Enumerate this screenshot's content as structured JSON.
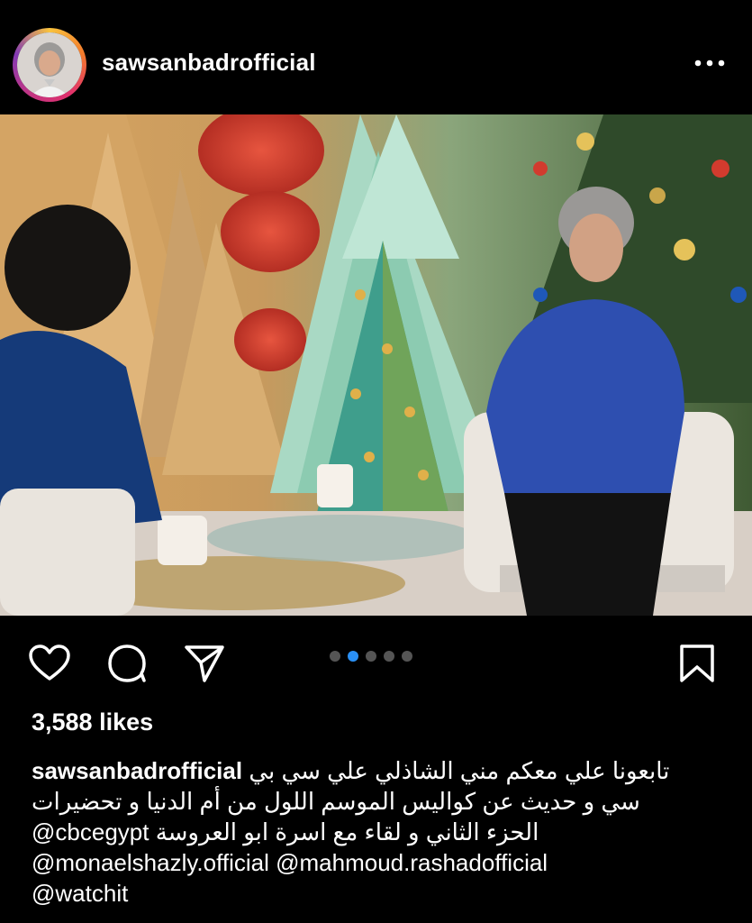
{
  "post": {
    "username": "sawsanbadrofficial",
    "more_icon": "more-horizontal-icon",
    "likes": "3,588 likes",
    "carousel": {
      "count": 5,
      "active_index": 1
    },
    "caption": {
      "line1_user": "sawsanbadrofficial",
      "line1_text": "تابعونا علي معكم مني الشاذلي علي سي بي",
      "line2_text": "سي و حديث عن كواليس الموسم اللول من أم الدنيا و تحضيرات",
      "line3_mention": "@cbcegypt",
      "line3_text": "الحزء الثاني و لقاء مع اسرة ابو العروسة",
      "line4_mention1": "@monaelshazly.official",
      "line4_mention2": "@mahmoud.rashadofficial",
      "line5_mention": "@watchit"
    }
  },
  "icons": {
    "like": "heart-icon",
    "comment": "comment-icon",
    "share": "send-icon",
    "save": "bookmark-icon"
  },
  "colors": {
    "background": "#000000",
    "carousel_active": "#2a90f5",
    "carousel_inactive": "#555555"
  }
}
